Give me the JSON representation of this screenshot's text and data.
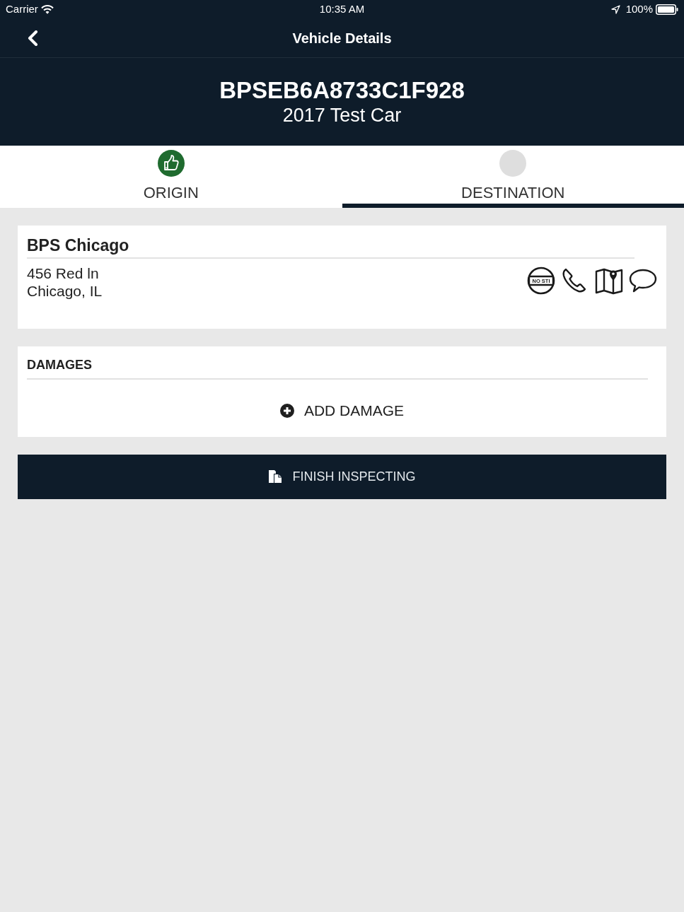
{
  "status_bar": {
    "carrier": "Carrier",
    "time": "10:35 AM",
    "battery_percent": "100%"
  },
  "nav_bar": {
    "title": "Vehicle Details"
  },
  "vehicle": {
    "id": "BPSEB6A8733C1F928",
    "name": "2017 Test Car"
  },
  "tabs": [
    {
      "label": "ORIGIN",
      "selected": false,
      "completed": true
    },
    {
      "label": "DESTINATION",
      "selected": true,
      "completed": false
    }
  ],
  "location": {
    "name": "BPS Chicago",
    "address_lines": [
      "456 Red ln",
      "Chicago, IL"
    ],
    "actions": [
      {
        "kind": "no-sti",
        "label": "NO STI"
      },
      {
        "kind": "phone"
      },
      {
        "kind": "map"
      },
      {
        "kind": "chat"
      }
    ]
  },
  "damages": {
    "title": "DAMAGES",
    "add_button": "ADD DAMAGE"
  },
  "finish_button": "FINISH INSPECTING"
}
